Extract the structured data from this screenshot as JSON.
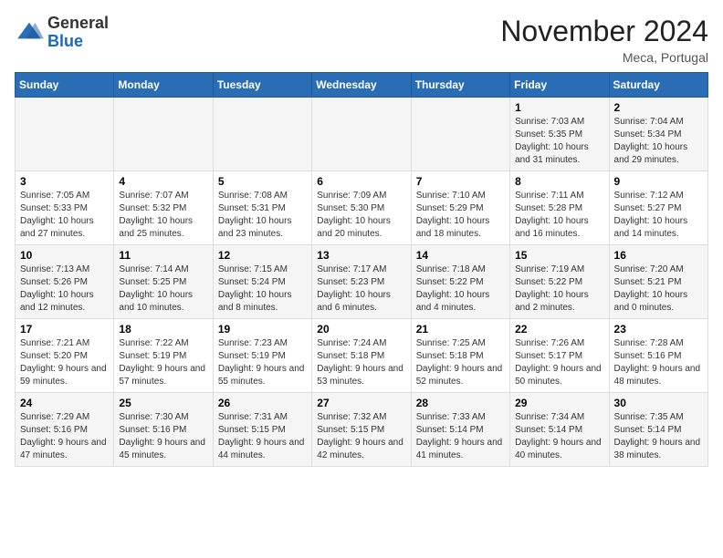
{
  "header": {
    "logo_line1": "General",
    "logo_line2": "Blue",
    "month_title": "November 2024",
    "location": "Meca, Portugal"
  },
  "weekdays": [
    "Sunday",
    "Monday",
    "Tuesday",
    "Wednesday",
    "Thursday",
    "Friday",
    "Saturday"
  ],
  "weeks": [
    [
      {
        "day": "",
        "info": ""
      },
      {
        "day": "",
        "info": ""
      },
      {
        "day": "",
        "info": ""
      },
      {
        "day": "",
        "info": ""
      },
      {
        "day": "",
        "info": ""
      },
      {
        "day": "1",
        "info": "Sunrise: 7:03 AM\nSunset: 5:35 PM\nDaylight: 10 hours and 31 minutes."
      },
      {
        "day": "2",
        "info": "Sunrise: 7:04 AM\nSunset: 5:34 PM\nDaylight: 10 hours and 29 minutes."
      }
    ],
    [
      {
        "day": "3",
        "info": "Sunrise: 7:05 AM\nSunset: 5:33 PM\nDaylight: 10 hours and 27 minutes."
      },
      {
        "day": "4",
        "info": "Sunrise: 7:07 AM\nSunset: 5:32 PM\nDaylight: 10 hours and 25 minutes."
      },
      {
        "day": "5",
        "info": "Sunrise: 7:08 AM\nSunset: 5:31 PM\nDaylight: 10 hours and 23 minutes."
      },
      {
        "day": "6",
        "info": "Sunrise: 7:09 AM\nSunset: 5:30 PM\nDaylight: 10 hours and 20 minutes."
      },
      {
        "day": "7",
        "info": "Sunrise: 7:10 AM\nSunset: 5:29 PM\nDaylight: 10 hours and 18 minutes."
      },
      {
        "day": "8",
        "info": "Sunrise: 7:11 AM\nSunset: 5:28 PM\nDaylight: 10 hours and 16 minutes."
      },
      {
        "day": "9",
        "info": "Sunrise: 7:12 AM\nSunset: 5:27 PM\nDaylight: 10 hours and 14 minutes."
      }
    ],
    [
      {
        "day": "10",
        "info": "Sunrise: 7:13 AM\nSunset: 5:26 PM\nDaylight: 10 hours and 12 minutes."
      },
      {
        "day": "11",
        "info": "Sunrise: 7:14 AM\nSunset: 5:25 PM\nDaylight: 10 hours and 10 minutes."
      },
      {
        "day": "12",
        "info": "Sunrise: 7:15 AM\nSunset: 5:24 PM\nDaylight: 10 hours and 8 minutes."
      },
      {
        "day": "13",
        "info": "Sunrise: 7:17 AM\nSunset: 5:23 PM\nDaylight: 10 hours and 6 minutes."
      },
      {
        "day": "14",
        "info": "Sunrise: 7:18 AM\nSunset: 5:22 PM\nDaylight: 10 hours and 4 minutes."
      },
      {
        "day": "15",
        "info": "Sunrise: 7:19 AM\nSunset: 5:22 PM\nDaylight: 10 hours and 2 minutes."
      },
      {
        "day": "16",
        "info": "Sunrise: 7:20 AM\nSunset: 5:21 PM\nDaylight: 10 hours and 0 minutes."
      }
    ],
    [
      {
        "day": "17",
        "info": "Sunrise: 7:21 AM\nSunset: 5:20 PM\nDaylight: 9 hours and 59 minutes."
      },
      {
        "day": "18",
        "info": "Sunrise: 7:22 AM\nSunset: 5:19 PM\nDaylight: 9 hours and 57 minutes."
      },
      {
        "day": "19",
        "info": "Sunrise: 7:23 AM\nSunset: 5:19 PM\nDaylight: 9 hours and 55 minutes."
      },
      {
        "day": "20",
        "info": "Sunrise: 7:24 AM\nSunset: 5:18 PM\nDaylight: 9 hours and 53 minutes."
      },
      {
        "day": "21",
        "info": "Sunrise: 7:25 AM\nSunset: 5:18 PM\nDaylight: 9 hours and 52 minutes."
      },
      {
        "day": "22",
        "info": "Sunrise: 7:26 AM\nSunset: 5:17 PM\nDaylight: 9 hours and 50 minutes."
      },
      {
        "day": "23",
        "info": "Sunrise: 7:28 AM\nSunset: 5:16 PM\nDaylight: 9 hours and 48 minutes."
      }
    ],
    [
      {
        "day": "24",
        "info": "Sunrise: 7:29 AM\nSunset: 5:16 PM\nDaylight: 9 hours and 47 minutes."
      },
      {
        "day": "25",
        "info": "Sunrise: 7:30 AM\nSunset: 5:16 PM\nDaylight: 9 hours and 45 minutes."
      },
      {
        "day": "26",
        "info": "Sunrise: 7:31 AM\nSunset: 5:15 PM\nDaylight: 9 hours and 44 minutes."
      },
      {
        "day": "27",
        "info": "Sunrise: 7:32 AM\nSunset: 5:15 PM\nDaylight: 9 hours and 42 minutes."
      },
      {
        "day": "28",
        "info": "Sunrise: 7:33 AM\nSunset: 5:14 PM\nDaylight: 9 hours and 41 minutes."
      },
      {
        "day": "29",
        "info": "Sunrise: 7:34 AM\nSunset: 5:14 PM\nDaylight: 9 hours and 40 minutes."
      },
      {
        "day": "30",
        "info": "Sunrise: 7:35 AM\nSunset: 5:14 PM\nDaylight: 9 hours and 38 minutes."
      }
    ]
  ]
}
